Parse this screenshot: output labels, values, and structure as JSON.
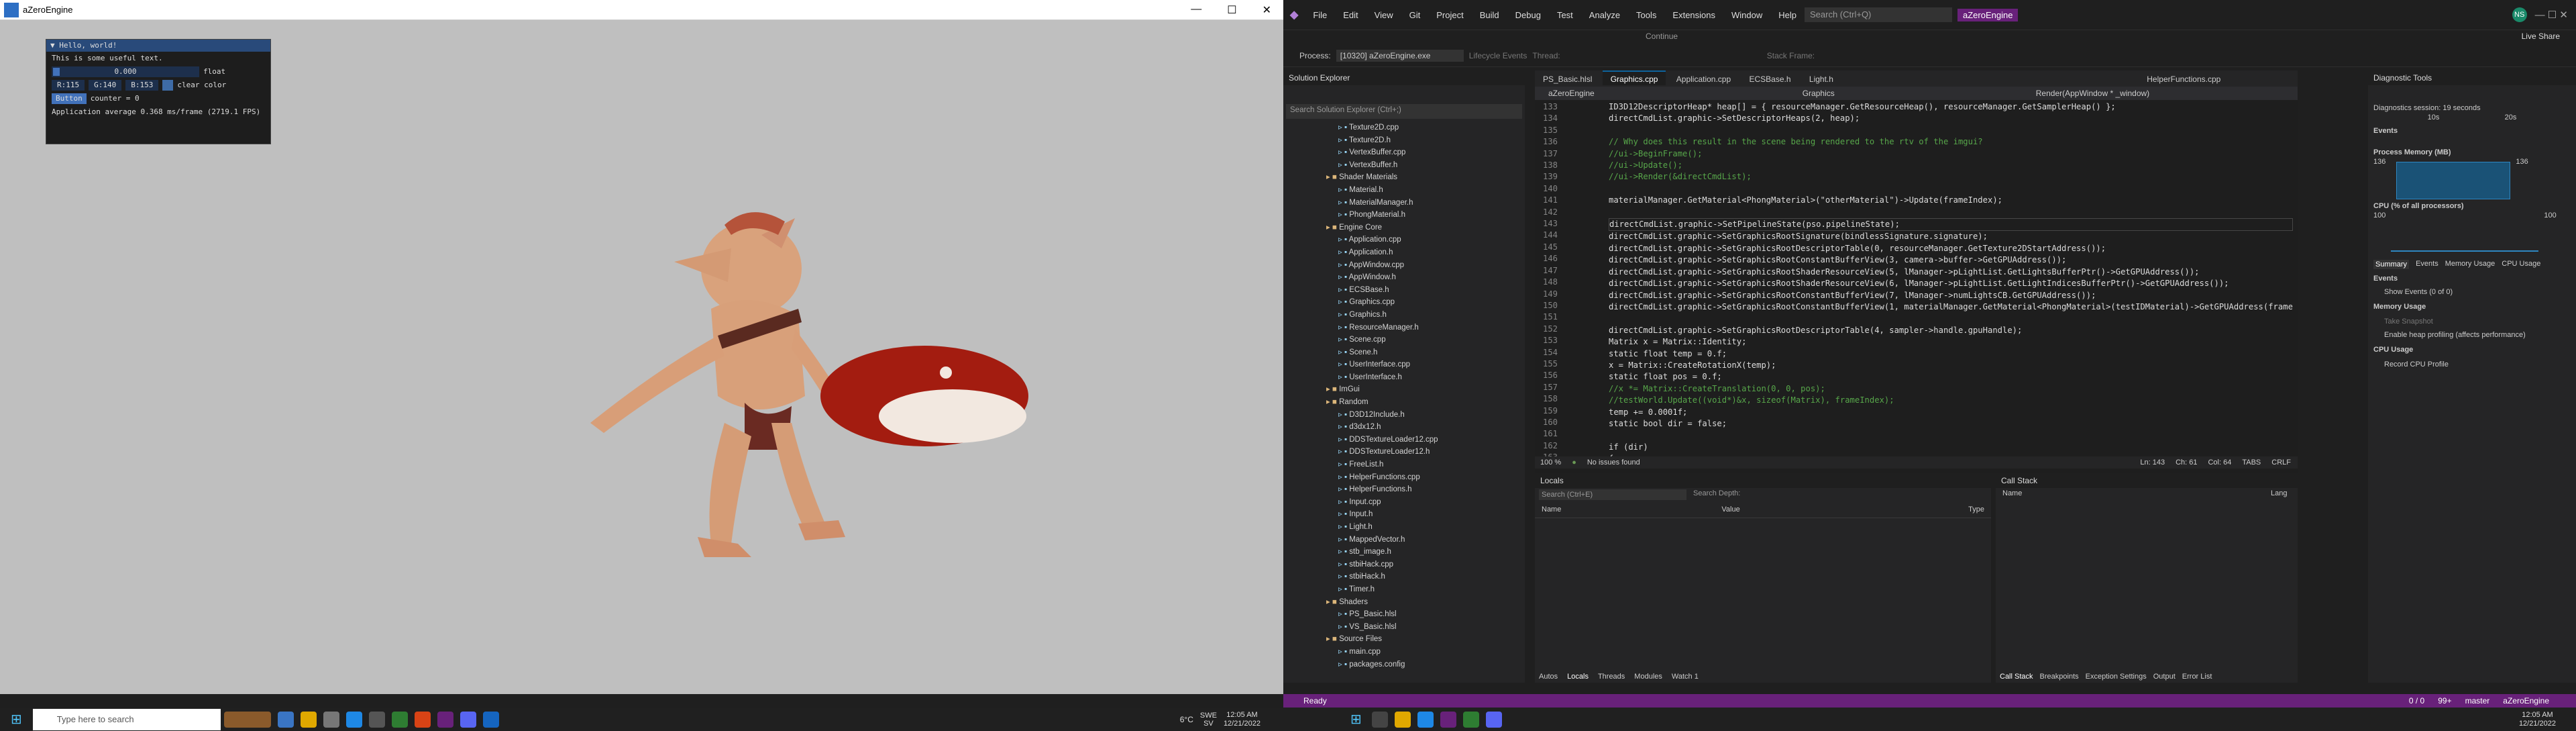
{
  "game_window": {
    "title": "aZeroEngine",
    "imgui": {
      "header": "Hello, world!",
      "text": "This is some useful text.",
      "float_value": "0.000",
      "float_label": "float",
      "r": "R:115",
      "g": "G:140",
      "b": "B:153",
      "clear_label": "clear color",
      "button": "Button",
      "counter": "counter = 0",
      "fps": "Application average 0.368 ms/frame (2719.1 FPS)"
    }
  },
  "vs": {
    "menu": [
      "File",
      "Edit",
      "View",
      "Git",
      "Project",
      "Build",
      "Debug",
      "Test",
      "Analyze",
      "Tools",
      "Extensions",
      "Window",
      "Help"
    ],
    "search": "Search (Ctrl+Q)",
    "project_badge": "aZeroEngine",
    "user_initials": "NS",
    "live_share": "Live Share",
    "continue": "Continue",
    "process": "Process:",
    "process_value": "[10320] aZeroEngine.exe",
    "lifecycle": "Lifecycle Events",
    "thread": "Thread:",
    "stack_frame": "Stack Frame:",
    "solution_explorer": {
      "title": "Solution Explorer",
      "search": "Search Solution Explorer (Ctrl+;)",
      "items": [
        "Texture2D.cpp",
        "Texture2D.h",
        "VertexBuffer.cpp",
        "VertexBuffer.h",
        "Shader Materials",
        "Material.h",
        "MaterialManager.h",
        "PhongMaterial.h",
        "Engine Core",
        "Application.cpp",
        "Application.h",
        "AppWindow.cpp",
        "AppWindow.h",
        "ECSBase.h",
        "Graphics.cpp",
        "Graphics.h",
        "ResourceManager.h",
        "Scene.cpp",
        "Scene.h",
        "UserInterface.cpp",
        "UserInterface.h",
        "ImGui",
        "Random",
        "D3D12Include.h",
        "d3dx12.h",
        "DDSTextureLoader12.cpp",
        "DDSTextureLoader12.h",
        "FreeList.h",
        "HelperFunctions.cpp",
        "HelperFunctions.h",
        "Input.cpp",
        "Input.h",
        "Light.h",
        "MappedVector.h",
        "stb_image.h",
        "stbiHack.cpp",
        "stbiHack.h",
        "Timer.h",
        "Shaders",
        "PS_Basic.hlsl",
        "VS_Basic.hlsl",
        "Source Files",
        "main.cpp",
        "packages.config"
      ]
    },
    "tabs": [
      "PS_Basic.hlsl",
      "Graphics.cpp",
      "Application.cpp",
      "ECSBase.h",
      "Light.h",
      "HelperFunctions.cpp"
    ],
    "nav": [
      "aZeroEngine",
      "Graphics",
      "Render(AppWindow * _window)"
    ],
    "code_lines": [
      {
        "n": "133",
        "t": "ID3D12DescriptorHeap* heap[] = { resourceManager.GetResourceHeap(), resourceManager.GetSamplerHeap() };"
      },
      {
        "n": "134",
        "t": "directCmdList.graphic->SetDescriptorHeaps(2, heap);"
      },
      {
        "n": "135",
        "t": ""
      },
      {
        "n": "136",
        "t": "// Why does this result in the scene being rendered to the rtv of the imgui?",
        "c": "cm"
      },
      {
        "n": "137",
        "t": "//ui->BeginFrame();",
        "c": "cm"
      },
      {
        "n": "138",
        "t": "//ui->Update();",
        "c": "cm"
      },
      {
        "n": "139",
        "t": "//ui->Render(&directCmdList);",
        "c": "cm"
      },
      {
        "n": "140",
        "t": ""
      },
      {
        "n": "141",
        "t": "materialManager.GetMaterial<PhongMaterial>(\"otherMaterial\")->Update(frameIndex);"
      },
      {
        "n": "142",
        "t": ""
      },
      {
        "n": "143",
        "t": "directCmdList.graphic->SetPipelineState(pso.pipelineState);"
      },
      {
        "n": "144",
        "t": "directCmdList.graphic->SetGraphicsRootSignature(bindlessSignature.signature);"
      },
      {
        "n": "145",
        "t": "directCmdList.graphic->SetGraphicsRootDescriptorTable(0, resourceManager.GetTexture2DStartAddress());"
      },
      {
        "n": "146",
        "t": "directCmdList.graphic->SetGraphicsRootConstantBufferView(3, camera->buffer->GetGPUAddress());"
      },
      {
        "n": "147",
        "t": "directCmdList.graphic->SetGraphicsRootShaderResourceView(5, lManager->pLightList.GetLightsBufferPtr()->GetGPUAddress());"
      },
      {
        "n": "148",
        "t": "directCmdList.graphic->SetGraphicsRootShaderResourceView(6, lManager->pLightList.GetLightIndicesBufferPtr()->GetGPUAddress());"
      },
      {
        "n": "149",
        "t": "directCmdList.graphic->SetGraphicsRootConstantBufferView(7, lManager->numLightsCB.GetGPUAddress());"
      },
      {
        "n": "150",
        "t": "directCmdList.graphic->SetGraphicsRootConstantBufferView(1, materialManager.GetMaterial<PhongMaterial>(testIDMaterial)->GetGPUAddress(frameInde"
      },
      {
        "n": "151",
        "t": ""
      },
      {
        "n": "152",
        "t": "directCmdList.graphic->SetGraphicsRootDescriptorTable(4, sampler->handle.gpuHandle);"
      },
      {
        "n": "153",
        "t": "Matrix x = Matrix::Identity;"
      },
      {
        "n": "154",
        "t": "static float temp = 0.f;"
      },
      {
        "n": "155",
        "t": "x = Matrix::CreateRotationX(temp);"
      },
      {
        "n": "156",
        "t": "static float pos = 0.f;"
      },
      {
        "n": "157",
        "t": "//x *= Matrix::CreateTranslation(0, 0, pos);",
        "c": "cm"
      },
      {
        "n": "158",
        "t": "//testWorld.Update((void*)&x, sizeof(Matrix), frameIndex);",
        "c": "cm"
      },
      {
        "n": "159",
        "t": "temp += 0.0001f;"
      },
      {
        "n": "160",
        "t": "static bool dir = false;"
      },
      {
        "n": "161",
        "t": ""
      },
      {
        "n": "162",
        "t": "if (dir)"
      },
      {
        "n": "163",
        "t": "{"
      }
    ],
    "editor_status": {
      "zoom": "100 %",
      "issues": "No issues found",
      "ln": "Ln: 143",
      "ch": "Ch: 61",
      "col": "Col: 64",
      "tabs": "TABS",
      "crlf": "CRLF"
    },
    "locals": {
      "title": "Locals",
      "search": "Search (Ctrl+E)",
      "depth": "Search Depth:",
      "cols": [
        "Name",
        "Value",
        "Type"
      ]
    },
    "callstack": {
      "title": "Call Stack",
      "cols": [
        "Name",
        "Lang"
      ]
    },
    "bottom_tabs_left": [
      "Autos",
      "Locals",
      "Threads",
      "Modules",
      "Watch 1"
    ],
    "bottom_tabs_right": [
      "Call Stack",
      "Breakpoints",
      "Exception Settings",
      "Output",
      "Error List"
    ],
    "diag": {
      "title": "Diagnostic Tools",
      "session": "Diagnostics session: 19 seconds",
      "t1": "10s",
      "t2": "20s",
      "events": "Events",
      "memory": "Process Memory (MB)",
      "mem_hi": "136",
      "mem_lo": "0",
      "cpu": "CPU (% of all processors)",
      "cpu_hi": "100",
      "cpu_lo": "0",
      "tabs": [
        "Summary",
        "Events",
        "Memory Usage",
        "CPU Usage"
      ],
      "events_hdr": "Events",
      "show_events": "Show Events (0 of 0)",
      "mem_hdr": "Memory Usage",
      "snapshot": "Take Snapshot",
      "heap": "Enable heap profiling (affects performance)",
      "cpu_hdr": "CPU Usage",
      "record": "Record CPU Profile"
    },
    "status": {
      "ready": "Ready",
      "errs": "0 / 0",
      "plus": "99+",
      "branch": "master",
      "repo": "aZeroEngine"
    }
  },
  "taskbar": {
    "search": "Type here to search",
    "temp": "6°C",
    "lang": "SWE",
    "lang2": "SV",
    "time": "12:05 AM",
    "date": "12/21/2022",
    "time2": "12:05 AM",
    "date2": "12/21/2022"
  }
}
